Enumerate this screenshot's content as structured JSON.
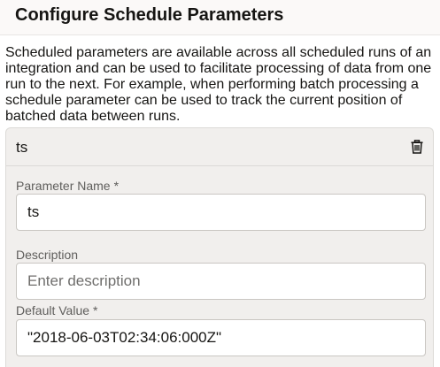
{
  "dialog": {
    "title": "Configure Schedule Parameters",
    "description": "Scheduled parameters are available across all scheduled runs of an integration and can be used to facilitate processing of data from one run to the next. For example, when performing batch processing a schedule parameter can be used to track the current position of batched data between runs."
  },
  "parameter": {
    "card_title": "ts",
    "delete_icon": "trash-icon",
    "fields": {
      "name": {
        "label": "Parameter Name",
        "required_mark": "*",
        "value": "ts"
      },
      "description": {
        "label": "Description",
        "value": "",
        "placeholder": "Enter description"
      },
      "default_value": {
        "label": "Default Value",
        "required_mark": "*",
        "value": "\"2018-06-03T02:34:06:000Z\""
      }
    }
  },
  "colors": {
    "card_background": "#f1efed",
    "header_background": "#fbf9f8",
    "text_primary": "#161513",
    "text_secondary": "#5f5e5c",
    "input_border": "#c9c6c2"
  }
}
